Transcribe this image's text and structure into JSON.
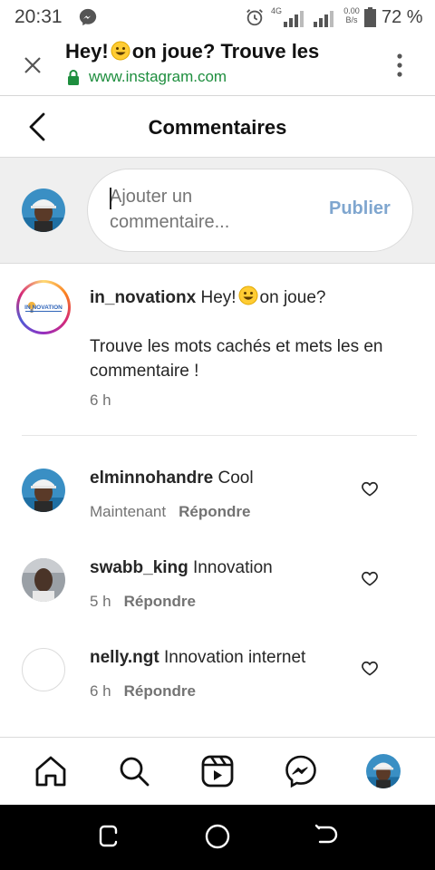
{
  "status_bar": {
    "time": "20:31",
    "network_type": "4G",
    "speed_value": "0.00",
    "speed_unit": "B/s",
    "battery": "72 %"
  },
  "browser": {
    "title_part1": "Hey!",
    "title_part2": "on joue? Trouve les",
    "url": "www.instagram.com"
  },
  "ig_header": {
    "title": "Commentaires"
  },
  "compose": {
    "placeholder": "Ajouter un commentaire...",
    "publish_label": "Publier"
  },
  "caption": {
    "username": "in_novationx",
    "text_part1": "Hey!",
    "text_part2": "on joue?",
    "text_line2": "Trouve les mots cachés et mets les en commentaire !",
    "time": "6 h",
    "logo_text": "IN NOVATION"
  },
  "comments": [
    {
      "username": "elminnohandre",
      "text": "Cool",
      "time": "Maintenant",
      "reply_label": "Répondre"
    },
    {
      "username": "swabb_king",
      "text": "Innovation",
      "time": "5 h",
      "reply_label": "Répondre"
    },
    {
      "username": "nelly.ngt",
      "text": "Innovation internet",
      "time": "6 h",
      "reply_label": "Répondre"
    }
  ],
  "icons": {
    "status": [
      "messenger-icon",
      "alarm-icon",
      "signal-icon",
      "battery-icon"
    ],
    "bottom_nav": [
      "home-icon",
      "search-icon",
      "reels-icon",
      "messenger-icon",
      "profile-avatar"
    ],
    "system_nav": [
      "recents-icon",
      "home-button-icon",
      "back-icon"
    ]
  },
  "colors": {
    "publish": "#7fa6cf",
    "url_green": "#1e8e3e",
    "secondary_text": "#737373"
  }
}
